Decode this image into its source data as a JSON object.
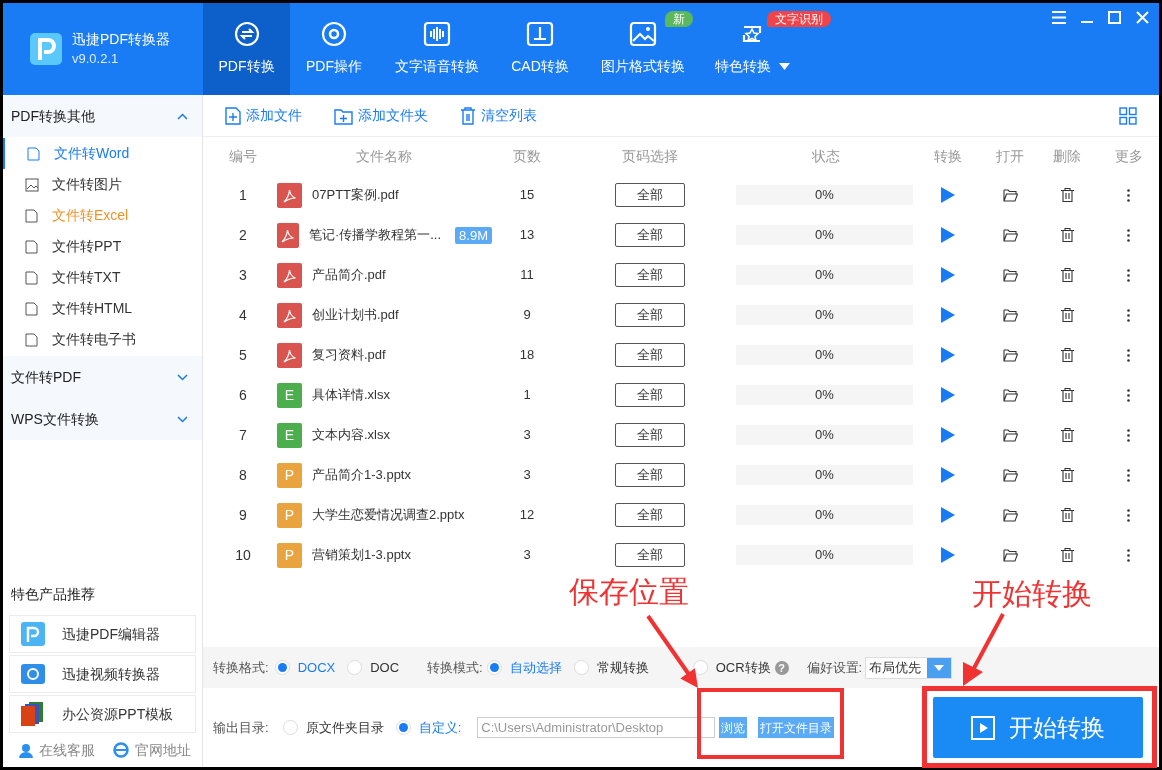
{
  "app": {
    "title": "迅捷PDF转换器",
    "version": "v9.0.2.1"
  },
  "nav_tabs": [
    {
      "label": "PDF转换",
      "selected": true
    },
    {
      "label": "PDF操作",
      "selected": false
    },
    {
      "label": "文字语音转换",
      "selected": false
    },
    {
      "label": "CAD转换",
      "selected": false
    },
    {
      "label": "图片格式转换",
      "selected": false,
      "badge": {
        "text": "新",
        "color": "#5cb85c"
      }
    },
    {
      "label": "特色转换",
      "selected": false,
      "dropdown": true,
      "badge": {
        "text": "文字识别",
        "color": "#f0434a"
      }
    }
  ],
  "sidebar": {
    "sections": [
      {
        "label": "PDF转换其他",
        "expanded": true,
        "children": [
          {
            "label": "文件转Word",
            "selected": true,
            "hovered": false
          },
          {
            "label": "文件转图片",
            "selected": false,
            "hovered": false
          },
          {
            "label": "文件转Excel",
            "selected": false,
            "hovered": true
          },
          {
            "label": "文件转PPT",
            "selected": false,
            "hovered": false
          },
          {
            "label": "文件转TXT",
            "selected": false,
            "hovered": false
          },
          {
            "label": "文件转HTML",
            "selected": false,
            "hovered": false
          },
          {
            "label": "文件转电子书",
            "selected": false,
            "hovered": false
          }
        ]
      },
      {
        "label": "文件转PDF",
        "expanded": false
      },
      {
        "label": "WPS文件转换",
        "expanded": false
      }
    ],
    "recommend_title": "特色产品推荐",
    "products": [
      {
        "label": "迅捷PDF编辑器",
        "kind": "pdf"
      },
      {
        "label": "迅捷视频转换器",
        "kind": "video"
      },
      {
        "label": "办公资源PPT模板",
        "kind": "ppt"
      }
    ],
    "footer_links": [
      {
        "label": "在线客服",
        "kind": "service"
      },
      {
        "label": "官网地址",
        "kind": "web"
      }
    ]
  },
  "toolbar": [
    {
      "label": "添加文件",
      "kind": "file"
    },
    {
      "label": "添加文件夹",
      "kind": "folder"
    },
    {
      "label": "清空列表",
      "kind": "trash"
    }
  ],
  "table": {
    "columns": [
      "编号",
      "文件名称",
      "页数",
      "页码选择",
      "状态",
      "转换",
      "打开",
      "删除",
      "更多"
    ],
    "rows": [
      {
        "no": "1",
        "kind": "pdf",
        "name": "07PTT案例.pdf",
        "pages": "15",
        "range": "全部",
        "status": "0%",
        "level": 0
      },
      {
        "no": "2",
        "kind": "pdf",
        "name": "笔记·传播学教程第一...",
        "size": "8.9M",
        "pages": "13",
        "range": "全部",
        "status": "0%",
        "level": 0
      },
      {
        "no": "3",
        "kind": "pdf",
        "name": "产品简介.pdf",
        "pages": "11",
        "range": "全部",
        "status": "0%",
        "level": 0
      },
      {
        "no": "4",
        "kind": "pdf",
        "name": "创业计划书.pdf",
        "pages": "9",
        "range": "全部",
        "status": "0%",
        "level": 0
      },
      {
        "no": "5",
        "kind": "pdf",
        "name": "复习资料.pdf",
        "pages": "18",
        "range": "全部",
        "status": "0%",
        "level": 0
      },
      {
        "no": "6",
        "kind": "xlsx",
        "letter": "E",
        "name": "具体详情.xlsx",
        "pages": "1",
        "range": "全部",
        "status": "0%",
        "level": 0
      },
      {
        "no": "7",
        "kind": "xlsx",
        "letter": "E",
        "name": "文本内容.xlsx",
        "pages": "3",
        "range": "全部",
        "status": "0%",
        "level": 0
      },
      {
        "no": "8",
        "kind": "pptx",
        "letter": "P",
        "name": "产品简介1-3.pptx",
        "pages": "3",
        "range": "全部",
        "status": "0%",
        "level": 0
      },
      {
        "no": "9",
        "kind": "pptx",
        "letter": "P",
        "name": "大学生恋爱情况调查2.pptx",
        "pages": "12",
        "range": "全部",
        "status": "0%",
        "level": 0
      },
      {
        "no": "10",
        "kind": "pptx",
        "letter": "P",
        "name": "营销策划1-3.pptx",
        "pages": "3",
        "range": "全部",
        "status": "0%",
        "level": 0
      }
    ]
  },
  "options": {
    "format_label": "转换格式:",
    "formats": [
      {
        "label": "DOCX",
        "selected": true
      },
      {
        "label": "DOC",
        "selected": false
      }
    ],
    "mode_label": "转换模式:",
    "modes": [
      {
        "label": "自动选择",
        "selected": true
      },
      {
        "label": "常规转换",
        "selected": false
      },
      {
        "label": "OCR转换",
        "selected": false,
        "help": "?"
      }
    ],
    "preference_label": "偏好设置:",
    "preference": "布局优先"
  },
  "output": {
    "label": "输出目录:",
    "options": [
      {
        "label": "原文件夹目录",
        "selected": false
      },
      {
        "label": "自定义:",
        "selected": true
      }
    ],
    "path": "C:\\Users\\Administrator\\Desktop",
    "browse": "浏览",
    "open_dir": "打开文件目录"
  },
  "start_button": "开始转换",
  "annotations": [
    {
      "text": "保存位置"
    },
    {
      "text": "开始转换"
    }
  ]
}
